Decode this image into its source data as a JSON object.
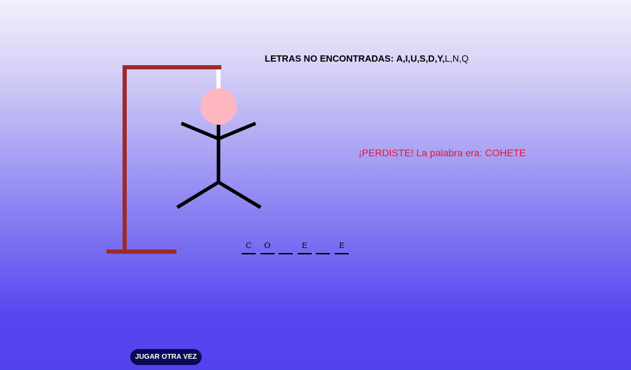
{
  "missed_letters": {
    "label": "LETRAS NO ENCONTRADAS:",
    "bold_letters": "A,I,U,S,D,Y,",
    "light_letters": "L,N,Q"
  },
  "result_message": "¡PERDISTE! La palabra era: COHETE",
  "word_slots": [
    "C",
    "O",
    "",
    "E",
    "",
    "E"
  ],
  "play_again_label": "JUGAR OTRA VEZ",
  "colors": {
    "gallows": "#a1282a",
    "rope": "#ffffff",
    "head": "#ffb6c1",
    "figure": "#000000",
    "result_text": "#ee1133",
    "button_bg": "#0a0a55"
  }
}
